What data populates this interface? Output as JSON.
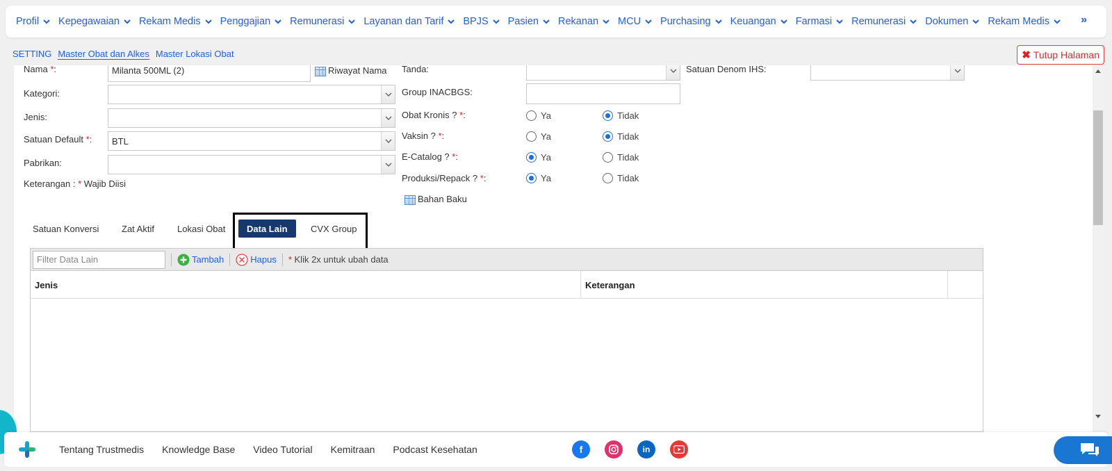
{
  "topnav": {
    "items": [
      "Profil",
      "Kepegawaian",
      "Rekam Medis",
      "Penggajian",
      "Remunerasi",
      "Layanan dan Tarif",
      "BPJS",
      "Pasien",
      "Rekanan",
      "MCU",
      "Purchasing",
      "Keuangan",
      "Farmasi",
      "Remunerasi",
      "Dokumen",
      "Rekam Medis"
    ],
    "more": "»"
  },
  "breadcrumb": {
    "items": [
      "SETTING",
      "Master Obat dan Alkes",
      "Master Lokasi Obat"
    ],
    "close_label": "Tutup Halaman"
  },
  "form": {
    "nama_label": "Nama",
    "nama_value": "Milanta 500ML (2)",
    "riwayat_nama": "Riwayat Nama",
    "kategori_label": "Kategori:",
    "jenis_label": "Jenis:",
    "satuan_default_label": "Satuan Default",
    "satuan_default_value": "BTL",
    "pabrikan_label": "Pabrikan:",
    "keterangan_label": "Keterangan :",
    "wajib_diisi": "Wajib Diisi",
    "tanda_label": "Tanda:",
    "group_inacbgs_label": "Group INACBGS:",
    "obat_kronis_label": "Obat Kronis ?",
    "vaksin_label": "Vaksin ?",
    "ecatalog_label": "E-Catalog ?",
    "produksi_label": "Produksi/Repack ?",
    "bahan_baku": "Bahan Baku",
    "satuan_denom_label": "Satuan Denom IHS:",
    "ya": "Ya",
    "tidak": "Tidak",
    "colon_required": ":",
    "req_mark": "*"
  },
  "radios": {
    "obat_kronis": "Tidak",
    "vaksin": "Tidak",
    "ecatalog": "Ya",
    "produksi": "Ya"
  },
  "tabs": [
    "Satuan Konversi",
    "Zat Aktif",
    "Lokasi Obat",
    "Data Lain",
    "CVX Group"
  ],
  "active_tab": "Data Lain",
  "grid": {
    "filter_placeholder": "Filter Data Lain",
    "tambah": "Tambah",
    "hapus": "Hapus",
    "note": "Klik 2x untuk ubah data",
    "columns": [
      "Jenis",
      "Keterangan"
    ]
  },
  "footer": {
    "links": [
      "Tentang Trustmedis",
      "Knowledge Base",
      "Video Tutorial",
      "Kemitraan",
      "Podcast Kesehatan"
    ]
  },
  "colors": {
    "accent": "#1f5fe8",
    "active_tab": "#17386c",
    "danger": "#e02020"
  }
}
